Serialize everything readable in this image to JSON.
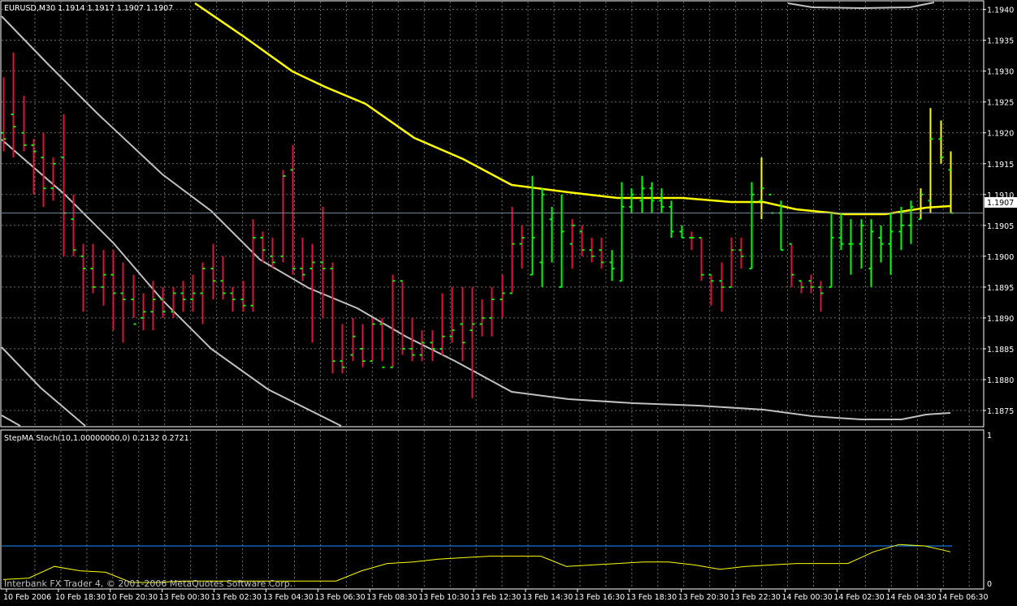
{
  "main_panel": {
    "symbol_info": "EURUSD,M30  1.1914 1.1917 1.1907 1.1907",
    "current_price_label": "1.1907",
    "price_ticks": [
      "1.1940",
      "1.1935",
      "1.1930",
      "1.1925",
      "1.1920",
      "1.1915",
      "1.1910",
      "1.1905",
      "1.1900",
      "1.1895",
      "1.1890",
      "1.1885",
      "1.1880",
      "1.1875"
    ]
  },
  "sub_panel": {
    "indicator_info": "StepMA Stoch(10,1.00000000,0) 0.2132 0.2721",
    "scale_top": "1",
    "scale_bottom": "0"
  },
  "time_ticks": [
    "10 Feb 2006",
    "10 Feb 18:30",
    "10 Feb 20:30",
    "13 Feb 00:30",
    "13 Feb 02:30",
    "13 Feb 04:30",
    "13 Feb 06:30",
    "13 Feb 08:30",
    "13 Feb 10:30",
    "13 Feb 12:30",
    "13 Feb 14:30",
    "13 Feb 16:30",
    "13 Feb 18:30",
    "13 Feb 20:30",
    "13 Feb 22:30",
    "14 Feb 00:30",
    "14 Feb 02:30",
    "14 Feb 04:30",
    "14 Feb 06:30"
  ],
  "watermark": "Interbank FX Trader 4, © 2001-2006 MetaQuotes Software Corp.",
  "colors": {
    "background": "#000000",
    "grid": "#6b6b6b",
    "axis": "#ffffff",
    "bear_bar": "#dc143c",
    "bull_bar": "#00ff00",
    "neutral_bar": "#ffff00",
    "ma_line": "#ffff00",
    "envelope_line": "#c0c0c0",
    "current_price_line": "#778899",
    "stoch_line": "#ffff00",
    "stoch_level": "#1e90ff"
  },
  "chart_data": {
    "type": "ohlc",
    "symbol": "EURUSD",
    "timeframe": "M30",
    "last_ohlc": {
      "open": 1.1914,
      "high": 1.1917,
      "low": 1.1907,
      "close": 1.1907
    },
    "ylim": [
      1.18725,
      1.1941
    ],
    "bars": [
      {
        "o": 1.192,
        "h": 1.1929,
        "l": 1.1917,
        "c": 1.1919,
        "t": "bear"
      },
      {
        "o": 1.1923,
        "h": 1.1933,
        "l": 1.1916,
        "c": 1.1921,
        "t": "bear"
      },
      {
        "o": 1.192,
        "h": 1.1926,
        "l": 1.1917,
        "c": 1.1918,
        "t": "bear"
      },
      {
        "o": 1.1918,
        "h": 1.1919,
        "l": 1.191,
        "c": 1.1917,
        "t": "bear"
      },
      {
        "o": 1.1916,
        "h": 1.192,
        "l": 1.1908,
        "c": 1.1911,
        "t": "bear"
      },
      {
        "o": 1.1911,
        "h": 1.1916,
        "l": 1.1909,
        "c": 1.1915,
        "t": "bear"
      },
      {
        "o": 1.1916,
        "h": 1.1923,
        "l": 1.19,
        "c": 1.1907,
        "t": "bear"
      },
      {
        "o": 1.1906,
        "h": 1.191,
        "l": 1.19,
        "c": 1.1901,
        "t": "bear"
      },
      {
        "o": 1.19,
        "h": 1.1902,
        "l": 1.1891,
        "c": 1.1898,
        "t": "bear"
      },
      {
        "o": 1.1898,
        "h": 1.1902,
        "l": 1.1894,
        "c": 1.1895,
        "t": "bear"
      },
      {
        "o": 1.1895,
        "h": 1.1901,
        "l": 1.1892,
        "c": 1.1897,
        "t": "bear"
      },
      {
        "o": 1.1897,
        "h": 1.1901,
        "l": 1.1888,
        "c": 1.1894,
        "t": "bear"
      },
      {
        "o": 1.1894,
        "h": 1.1899,
        "l": 1.1886,
        "c": 1.1893,
        "t": "bear"
      },
      {
        "o": 1.1893,
        "h": 1.1897,
        "l": 1.189,
        "c": 1.1889,
        "t": "bear"
      },
      {
        "o": 1.189,
        "h": 1.1894,
        "l": 1.1888,
        "c": 1.1891,
        "t": "bear"
      },
      {
        "o": 1.1891,
        "h": 1.1896,
        "l": 1.1888,
        "c": 1.1893,
        "t": "bear"
      },
      {
        "o": 1.1893,
        "h": 1.1895,
        "l": 1.189,
        "c": 1.1891,
        "t": "bear"
      },
      {
        "o": 1.1891,
        "h": 1.1895,
        "l": 1.189,
        "c": 1.1894,
        "t": "bear"
      },
      {
        "o": 1.1894,
        "h": 1.1896,
        "l": 1.1891,
        "c": 1.1893,
        "t": "bear"
      },
      {
        "o": 1.1893,
        "h": 1.1897,
        "l": 1.1891,
        "c": 1.1894,
        "t": "bear"
      },
      {
        "o": 1.1894,
        "h": 1.1899,
        "l": 1.1889,
        "c": 1.1898,
        "t": "bear"
      },
      {
        "o": 1.1898,
        "h": 1.1902,
        "l": 1.1893,
        "c": 1.1896,
        "t": "bear"
      },
      {
        "o": 1.1896,
        "h": 1.19,
        "l": 1.1893,
        "c": 1.1894,
        "t": "bear"
      },
      {
        "o": 1.1894,
        "h": 1.1895,
        "l": 1.1891,
        "c": 1.1893,
        "t": "bear"
      },
      {
        "o": 1.1893,
        "h": 1.1896,
        "l": 1.1891,
        "c": 1.1892,
        "t": "bear"
      },
      {
        "o": 1.1892,
        "h": 1.1906,
        "l": 1.1891,
        "c": 1.1903,
        "t": "bear"
      },
      {
        "o": 1.1903,
        "h": 1.1904,
        "l": 1.1899,
        "c": 1.1901,
        "t": "bear"
      },
      {
        "o": 1.19,
        "h": 1.1903,
        "l": 1.1898,
        "c": 1.1899,
        "t": "bear"
      },
      {
        "o": 1.19,
        "h": 1.1914,
        "l": 1.1899,
        "c": 1.1913,
        "t": "bear"
      },
      {
        "o": 1.1914,
        "h": 1.1918,
        "l": 1.1897,
        "c": 1.1898,
        "t": "bear"
      },
      {
        "o": 1.1898,
        "h": 1.1903,
        "l": 1.1896,
        "c": 1.1897,
        "t": "bear"
      },
      {
        "o": 1.1898,
        "h": 1.1902,
        "l": 1.1886,
        "c": 1.1899,
        "t": "bear"
      },
      {
        "o": 1.1899,
        "h": 1.1908,
        "l": 1.189,
        "c": 1.1898,
        "t": "bear"
      },
      {
        "o": 1.1898,
        "h": 1.1899,
        "l": 1.1881,
        "c": 1.1883,
        "t": "bear"
      },
      {
        "o": 1.1883,
        "h": 1.1889,
        "l": 1.1881,
        "c": 1.1882,
        "t": "bear"
      },
      {
        "o": 1.1884,
        "h": 1.189,
        "l": 1.1883,
        "c": 1.1887,
        "t": "bear"
      },
      {
        "o": 1.1885,
        "h": 1.1889,
        "l": 1.1882,
        "c": 1.1883,
        "t": "bear"
      },
      {
        "o": 1.1883,
        "h": 1.189,
        "l": 1.1883,
        "c": 1.1889,
        "t": "bear"
      },
      {
        "o": 1.1889,
        "h": 1.189,
        "l": 1.1883,
        "c": 1.1882,
        "t": "bear"
      },
      {
        "o": 1.1882,
        "h": 1.1897,
        "l": 1.1882,
        "c": 1.1896,
        "t": "bear"
      },
      {
        "o": 1.1896,
        "h": 1.1896,
        "l": 1.1884,
        "c": 1.1885,
        "t": "bear"
      },
      {
        "o": 1.1885,
        "h": 1.189,
        "l": 1.1883,
        "c": 1.1884,
        "t": "bear"
      },
      {
        "o": 1.1884,
        "h": 1.1888,
        "l": 1.1883,
        "c": 1.1886,
        "t": "bear"
      },
      {
        "o": 1.1886,
        "h": 1.1888,
        "l": 1.1883,
        "c": 1.1885,
        "t": "bear"
      },
      {
        "o": 1.1885,
        "h": 1.1894,
        "l": 1.1884,
        "c": 1.1887,
        "t": "bear"
      },
      {
        "o": 1.1887,
        "h": 1.1895,
        "l": 1.1886,
        "c": 1.1888,
        "t": "bear"
      },
      {
        "o": 1.1889,
        "h": 1.1895,
        "l": 1.1883,
        "c": 1.1886,
        "t": "bear"
      },
      {
        "o": 1.1888,
        "h": 1.1895,
        "l": 1.1877,
        "c": 1.1889,
        "t": "bear"
      },
      {
        "o": 1.1889,
        "h": 1.1893,
        "l": 1.1887,
        "c": 1.189,
        "t": "bear"
      },
      {
        "o": 1.189,
        "h": 1.1895,
        "l": 1.1887,
        "c": 1.1893,
        "t": "bear"
      },
      {
        "o": 1.1893,
        "h": 1.1897,
        "l": 1.189,
        "c": 1.1894,
        "t": "bear"
      },
      {
        "o": 1.1894,
        "h": 1.1908,
        "l": 1.1894,
        "c": 1.1902,
        "t": "bear"
      },
      {
        "o": 1.1902,
        "h": 1.1905,
        "l": 1.1898,
        "c": 1.1903,
        "t": "bear"
      },
      {
        "o": 1.1897,
        "h": 1.1913,
        "l": 1.1897,
        "c": 1.1903,
        "t": "bull"
      },
      {
        "o": 1.1899,
        "h": 1.1911,
        "l": 1.1895,
        "c": 1.191,
        "t": "bull"
      },
      {
        "o": 1.1906,
        "h": 1.1908,
        "l": 1.1899,
        "c": 1.1907,
        "t": "bull"
      },
      {
        "o": 1.1895,
        "h": 1.191,
        "l": 1.1895,
        "c": 1.1904,
        "t": "bull"
      },
      {
        "o": 1.1902,
        "h": 1.1906,
        "l": 1.1898,
        "c": 1.1905,
        "t": "bear"
      },
      {
        "o": 1.1904,
        "h": 1.1905,
        "l": 1.19,
        "c": 1.1901,
        "t": "bear"
      },
      {
        "o": 1.1901,
        "h": 1.1903,
        "l": 1.1899,
        "c": 1.19,
        "t": "bear"
      },
      {
        "o": 1.1901,
        "h": 1.1903,
        "l": 1.1898,
        "c": 1.1899,
        "t": "bear"
      },
      {
        "o": 1.1899,
        "h": 1.1901,
        "l": 1.1896,
        "c": 1.1898,
        "t": "bull"
      },
      {
        "o": 1.1896,
        "h": 1.1912,
        "l": 1.1896,
        "c": 1.1908,
        "t": "bull"
      },
      {
        "o": 1.1908,
        "h": 1.1911,
        "l": 1.1907,
        "c": 1.191,
        "t": "bull"
      },
      {
        "o": 1.1909,
        "h": 1.1913,
        "l": 1.1907,
        "c": 1.1911,
        "t": "bull"
      },
      {
        "o": 1.1911,
        "h": 1.1912,
        "l": 1.1907,
        "c": 1.1909,
        "t": "bull"
      },
      {
        "o": 1.1909,
        "h": 1.1911,
        "l": 1.1907,
        "c": 1.1908,
        "t": "bull"
      },
      {
        "o": 1.1908,
        "h": 1.1909,
        "l": 1.1903,
        "c": 1.1904,
        "t": "bull"
      },
      {
        "o": 1.1904,
        "h": 1.1905,
        "l": 1.1903,
        "c": 1.1903,
        "t": "bull"
      },
      {
        "o": 1.1903,
        "h": 1.1904,
        "l": 1.1901,
        "c": 1.1903,
        "t": "bear"
      },
      {
        "o": 1.1903,
        "h": 1.1903,
        "l": 1.1896,
        "c": 1.1897,
        "t": "bear"
      },
      {
        "o": 1.1897,
        "h": 1.1897,
        "l": 1.1892,
        "c": 1.1896,
        "t": "bear"
      },
      {
        "o": 1.1896,
        "h": 1.1899,
        "l": 1.1891,
        "c": 1.1895,
        "t": "bear"
      },
      {
        "o": 1.1895,
        "h": 1.1903,
        "l": 1.1895,
        "c": 1.1901,
        "t": "bear"
      },
      {
        "o": 1.1901,
        "h": 1.1903,
        "l": 1.1898,
        "c": 1.19,
        "t": "bear"
      },
      {
        "o": 1.1898,
        "h": 1.1912,
        "l": 1.1898,
        "c": 1.191,
        "t": "bull"
      },
      {
        "o": 1.1909,
        "h": 1.1916,
        "l": 1.1906,
        "c": 1.1911,
        "t": "neutral"
      },
      {
        "o": 1.191,
        "h": 1.1907,
        "l": 1.1907,
        "c": 1.1907,
        "t": "bull"
      },
      {
        "o": 1.1907,
        "h": 1.1909,
        "l": 1.1901,
        "c": 1.1901,
        "t": "bull"
      },
      {
        "o": 1.1902,
        "h": 1.1902,
        "l": 1.1895,
        "c": 1.1897,
        "t": "bear"
      },
      {
        "o": 1.1896,
        "h": 1.1896,
        "l": 1.1894,
        "c": 1.1895,
        "t": "bear"
      },
      {
        "o": 1.1896,
        "h": 1.1897,
        "l": 1.1894,
        "c": 1.1895,
        "t": "bear"
      },
      {
        "o": 1.1895,
        "h": 1.1896,
        "l": 1.1891,
        "c": 1.1894,
        "t": "bear"
      },
      {
        "o": 1.1895,
        "h": 1.1907,
        "l": 1.1895,
        "c": 1.1903,
        "t": "bull"
      },
      {
        "o": 1.1903,
        "h": 1.1907,
        "l": 1.1901,
        "c": 1.1902,
        "t": "bull"
      },
      {
        "o": 1.1902,
        "h": 1.1906,
        "l": 1.1897,
        "c": 1.1902,
        "t": "bull"
      },
      {
        "o": 1.1902,
        "h": 1.1906,
        "l": 1.1898,
        "c": 1.1905,
        "t": "bull"
      },
      {
        "o": 1.1898,
        "h": 1.1906,
        "l": 1.1895,
        "c": 1.1904,
        "t": "bull"
      },
      {
        "o": 1.1903,
        "h": 1.1905,
        "l": 1.1899,
        "c": 1.1902,
        "t": "bull"
      },
      {
        "o": 1.1902,
        "h": 1.1907,
        "l": 1.1897,
        "c": 1.1904,
        "t": "bull"
      },
      {
        "o": 1.1904,
        "h": 1.1908,
        "l": 1.1901,
        "c": 1.1905,
        "t": "bull"
      },
      {
        "o": 1.1905,
        "h": 1.1909,
        "l": 1.1902,
        "c": 1.1908,
        "t": "bull"
      },
      {
        "o": 1.1906,
        "h": 1.1911,
        "l": 1.1906,
        "c": 1.191,
        "t": "neutral"
      },
      {
        "o": 1.1909,
        "h": 1.1924,
        "l": 1.1907,
        "c": 1.1919,
        "t": "neutral"
      },
      {
        "o": 1.1919,
        "h": 1.1922,
        "l": 1.1915,
        "c": 1.1916,
        "t": "neutral"
      },
      {
        "o": 1.1914,
        "h": 1.1917,
        "l": 1.1907,
        "c": 1.1907,
        "t": "neutral"
      }
    ],
    "ma": [
      1.194,
      1.19391,
      1.1938,
      1.19366,
      1.19351,
      1.19335,
      1.19316,
      1.19296,
      1.19276,
      1.19256,
      1.19236,
      1.19213,
      1.1919,
      1.19167,
      1.19145,
      1.19125,
      1.19106,
      1.19096,
      1.19087,
      1.19079,
      1.19073,
      1.1907,
      1.19068,
      1.19067,
      1.19066,
      1.19065,
      1.19065,
      1.19065,
      1.19065,
      1.19065,
      1.19065,
      1.19065
    ],
    "envelope_upper_right": [
      1.1941,
      1.194,
      1.194,
      1.194,
      1.1941
    ],
    "envelope_lower": [
      1.1892,
      1.18895,
      1.1887,
      1.18845,
      1.1882,
      1.18795,
      1.18775,
      1.18765,
      1.18755,
      1.18748,
      1.18743,
      1.18742,
      1.18741,
      1.18741,
      1.1874,
      1.1874,
      1.1874,
      1.18739,
      1.18736,
      1.18733,
      1.18729,
      1.18726,
      1.18725,
      1.18725,
      1.18725,
      1.18725,
      1.18728,
      1.1873
    ],
    "stoch_level": 0.27,
    "stoch_values": [
      0.02,
      0.03,
      0.11,
      0.08,
      0.07,
      0.0,
      0.0,
      0.01,
      0.01,
      0.01,
      0.01,
      0.01,
      0.01,
      0.01,
      0.08,
      0.13,
      0.14,
      0.16,
      0.17,
      0.18,
      0.18,
      0.18,
      0.11,
      0.12,
      0.13,
      0.14,
      0.14,
      0.12,
      0.09,
      0.11,
      0.12,
      0.13,
      0.13,
      0.13,
      0.21,
      0.26,
      0.25,
      0.21
    ],
    "stoch_ylim": [
      0,
      1
    ]
  }
}
